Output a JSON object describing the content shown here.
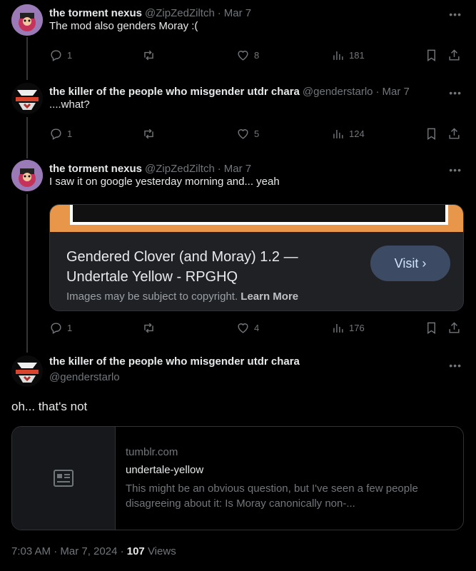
{
  "colors": {
    "background": "#000000",
    "text": "#e7e9ea",
    "muted": "#71767b",
    "card_accent": "#e8974a"
  },
  "tweets": [
    {
      "name": "the torment nexus",
      "handle": "@ZipZedZiltch",
      "sep": "·",
      "date": "Mar 7",
      "text": "The mod also genders Moray :(",
      "replies": "1",
      "likes": "8",
      "views": "181"
    },
    {
      "name": "the killer of the people who misgender utdr chara",
      "handle": "@genderstarlo",
      "sep": "·",
      "date": "Mar 7",
      "text": "....what?",
      "replies": "1",
      "likes": "5",
      "views": "124"
    },
    {
      "name": "the torment nexus",
      "handle": "@ZipZedZiltch",
      "sep": "·",
      "date": "Mar 7",
      "text": "I saw it on google yesterday morning and... yeah",
      "replies": "1",
      "likes": "4",
      "views": "176",
      "card": {
        "title": "Gendered Clover (and Moray) 1.2 — Undertale Yellow - RPGHQ",
        "visit": "Visit ›",
        "note": "Images may be subject to copyright.",
        "learn_more": "Learn More"
      }
    }
  ],
  "main": {
    "name": "the killer of the people who misgender utdr chara",
    "handle": "@genderstarlo",
    "text": "oh... that's not",
    "link": {
      "domain": "tumblr.com",
      "title": "undertale-yellow",
      "description": "This might be an obvious question, but I've seen a few people disagreeing about it: Is Moray canonically non-..."
    },
    "time": "7:03 AM · Mar 7, 2024 ·",
    "views_count": "107",
    "views_label": "Views"
  }
}
